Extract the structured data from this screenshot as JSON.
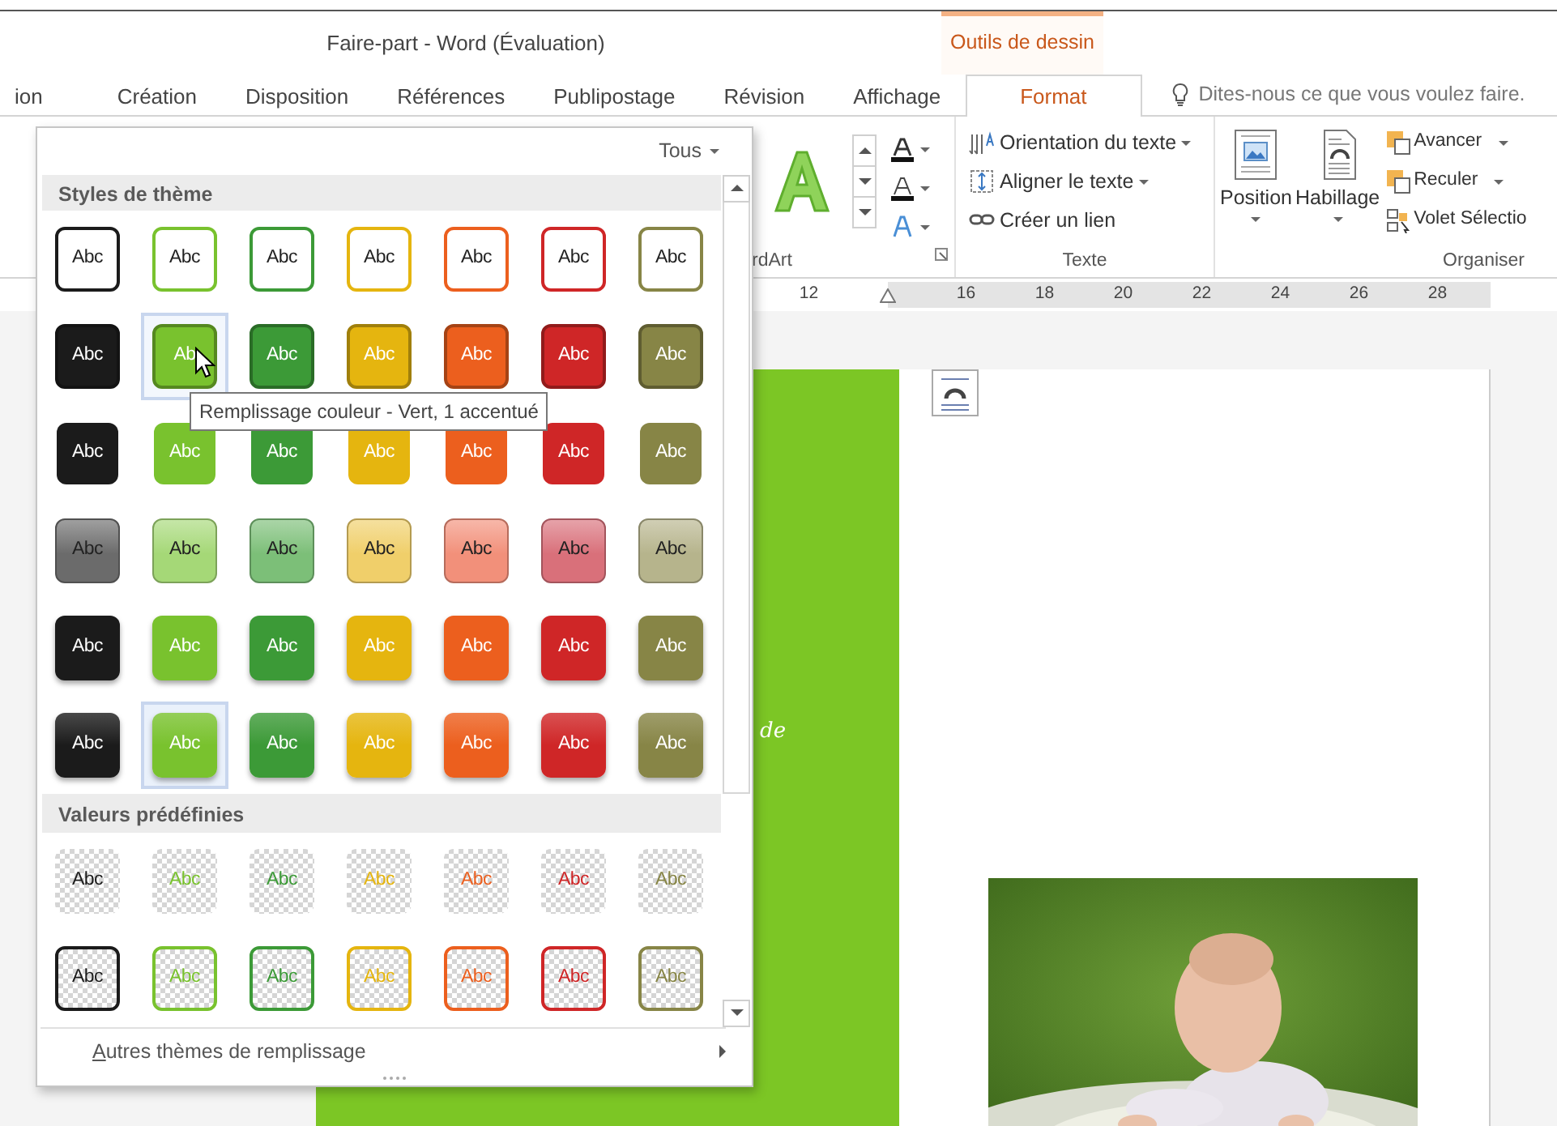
{
  "window": {
    "title": "Faire-part - Word (Évaluation)",
    "context_tab": "Outils de dessin"
  },
  "tabs": [
    {
      "label": "ion",
      "selected": false
    },
    {
      "label": "Création",
      "selected": false
    },
    {
      "label": "Disposition",
      "selected": false
    },
    {
      "label": "Références",
      "selected": false
    },
    {
      "label": "Publipostage",
      "selected": false
    },
    {
      "label": "Révision",
      "selected": false
    },
    {
      "label": "Affichage",
      "selected": false
    },
    {
      "label": "Format",
      "selected": true
    }
  ],
  "tell_me": {
    "placeholder": "Dites-nous ce que vous voulez faire."
  },
  "ribbon": {
    "wordart": {
      "label": "rdArt"
    },
    "texte": {
      "label": "Texte",
      "items": [
        {
          "label": "Orientation du texte",
          "dropdown": true
        },
        {
          "label": "Aligner le texte",
          "dropdown": true
        },
        {
          "label": "Créer un lien",
          "dropdown": false
        }
      ]
    },
    "organiser": {
      "label": "Organiser",
      "buttons": [
        {
          "label": "Position"
        },
        {
          "label": "Habillage"
        }
      ],
      "items": [
        {
          "label": "Avancer",
          "dropdown": true
        },
        {
          "label": "Reculer",
          "dropdown": true
        },
        {
          "label": "Volet Sélectio",
          "dropdown": false
        }
      ]
    }
  },
  "ruler": {
    "labels": [
      "12",
      "16",
      "18",
      "20",
      "22",
      "24",
      "26",
      "28"
    ]
  },
  "document": {
    "side_text": "de"
  },
  "gallery": {
    "filter": "Tous",
    "tooltip": "Remplissage couleur - Vert, 1 accentué",
    "footer": "Autres thèmes de remplissage",
    "sections": [
      {
        "title": "Styles de thème",
        "rows": [
          {
            "kind": "outline",
            "swatches": [
              {
                "label": "Abc",
                "color": "#1b1b1b",
                "selected": false,
                "hovered": false
              },
              {
                "label": "Abc",
                "color": "#79c22e",
                "selected": false,
                "hovered": false
              },
              {
                "label": "Abc",
                "color": "#3c9a37",
                "selected": false,
                "hovered": false
              },
              {
                "label": "Abc",
                "color": "#e5b50f",
                "selected": false,
                "hovered": false
              },
              {
                "label": "Abc",
                "color": "#ec5f1e",
                "selected": false,
                "hovered": false
              },
              {
                "label": "Abc",
                "color": "#cf2627",
                "selected": false,
                "hovered": false
              },
              {
                "label": "Abc",
                "color": "#878546",
                "selected": false,
                "hovered": false
              }
            ]
          },
          {
            "kind": "intense",
            "swatches": [
              {
                "label": "Abc",
                "color": "#1b1b1b",
                "selected": false,
                "hovered": false
              },
              {
                "label": "Ab",
                "color": "#79c22e",
                "selected": false,
                "hovered": true
              },
              {
                "label": "Abc",
                "color": "#3c9a37",
                "selected": false,
                "hovered": false
              },
              {
                "label": "Abc",
                "color": "#e5b50f",
                "selected": false,
                "hovered": false
              },
              {
                "label": "Abc",
                "color": "#ec5f1e",
                "selected": false,
                "hovered": false
              },
              {
                "label": "Abc",
                "color": "#cf2627",
                "selected": false,
                "hovered": false
              },
              {
                "label": "Abc",
                "color": "#878546",
                "selected": false,
                "hovered": false
              }
            ]
          },
          {
            "kind": "fill",
            "swatches": [
              {
                "label": "Abc",
                "color": "#1b1b1b",
                "selected": false,
                "hovered": false
              },
              {
                "label": "Abc",
                "color": "#79c22e",
                "selected": false,
                "hovered": false
              },
              {
                "label": "Abc",
                "color": "#3c9a37",
                "selected": false,
                "hovered": false
              },
              {
                "label": "Abc",
                "color": "#e5b50f",
                "selected": false,
                "hovered": false
              },
              {
                "label": "Abc",
                "color": "#ec5f1e",
                "selected": false,
                "hovered": false
              },
              {
                "label": "Abc",
                "color": "#cf2627",
                "selected": false,
                "hovered": false
              },
              {
                "label": "Abc",
                "color": "#878546",
                "selected": false,
                "hovered": false
              }
            ]
          },
          {
            "kind": "light",
            "swatches": [
              {
                "label": "Abc",
                "color": "#6b6b6b",
                "selected": false,
                "hovered": false
              },
              {
                "label": "Abc",
                "color": "#a5d877",
                "selected": false,
                "hovered": false
              },
              {
                "label": "Abc",
                "color": "#7cbf78",
                "selected": false,
                "hovered": false
              },
              {
                "label": "Abc",
                "color": "#f0cf6a",
                "selected": false,
                "hovered": false
              },
              {
                "label": "Abc",
                "color": "#f2907a",
                "selected": false,
                "hovered": false
              },
              {
                "label": "Abc",
                "color": "#d9707a",
                "selected": false,
                "hovered": false
              },
              {
                "label": "Abc",
                "color": "#b6b48c",
                "selected": false,
                "hovered": false
              }
            ]
          },
          {
            "kind": "shadow",
            "swatches": [
              {
                "label": "Abc",
                "color": "#1b1b1b",
                "selected": false,
                "hovered": false
              },
              {
                "label": "Abc",
                "color": "#79c22e",
                "selected": false,
                "hovered": false
              },
              {
                "label": "Abc",
                "color": "#3c9a37",
                "selected": false,
                "hovered": false
              },
              {
                "label": "Abc",
                "color": "#e5b50f",
                "selected": false,
                "hovered": false
              },
              {
                "label": "Abc",
                "color": "#ec5f1e",
                "selected": false,
                "hovered": false
              },
              {
                "label": "Abc",
                "color": "#cf2627",
                "selected": false,
                "hovered": false
              },
              {
                "label": "Abc",
                "color": "#878546",
                "selected": false,
                "hovered": false
              }
            ]
          },
          {
            "kind": "gradient",
            "swatches": [
              {
                "label": "Abc",
                "color": "#1b1b1b",
                "selected": false,
                "hovered": false
              },
              {
                "label": "Abc",
                "color": "#79c22e",
                "selected": true,
                "hovered": false
              },
              {
                "label": "Abc",
                "color": "#3c9a37",
                "selected": false,
                "hovered": false
              },
              {
                "label": "Abc",
                "color": "#e5b50f",
                "selected": false,
                "hovered": false
              },
              {
                "label": "Abc",
                "color": "#ec5f1e",
                "selected": false,
                "hovered": false
              },
              {
                "label": "Abc",
                "color": "#cf2627",
                "selected": false,
                "hovered": false
              },
              {
                "label": "Abc",
                "color": "#878546",
                "selected": false,
                "hovered": false
              }
            ]
          }
        ]
      },
      {
        "title": "Valeurs prédéfinies",
        "rows": [
          {
            "kind": "preset",
            "swatches": [
              {
                "label": "Abc",
                "color": "#1b1b1b",
                "selected": false,
                "hovered": false
              },
              {
                "label": "Abc",
                "color": "#79c22e",
                "selected": false,
                "hovered": false
              },
              {
                "label": "Abc",
                "color": "#3c9a37",
                "selected": false,
                "hovered": false
              },
              {
                "label": "Abc",
                "color": "#e5b50f",
                "selected": false,
                "hovered": false
              },
              {
                "label": "Abc",
                "color": "#ec5f1e",
                "selected": false,
                "hovered": false
              },
              {
                "label": "Abc",
                "color": "#cf2627",
                "selected": false,
                "hovered": false
              },
              {
                "label": "Abc",
                "color": "#878546",
                "selected": false,
                "hovered": false
              }
            ]
          },
          {
            "kind": "preset-outline",
            "swatches": [
              {
                "label": "Abc",
                "color": "#1b1b1b",
                "selected": false,
                "hovered": false
              },
              {
                "label": "Abc",
                "color": "#79c22e",
                "selected": false,
                "hovered": false
              },
              {
                "label": "Abc",
                "color": "#3c9a37",
                "selected": false,
                "hovered": false
              },
              {
                "label": "Abc",
                "color": "#e5b50f",
                "selected": false,
                "hovered": false
              },
              {
                "label": "Abc",
                "color": "#ec5f1e",
                "selected": false,
                "hovered": false
              },
              {
                "label": "Abc",
                "color": "#cf2627",
                "selected": false,
                "hovered": false
              },
              {
                "label": "Abc",
                "color": "#878546",
                "selected": false,
                "hovered": false
              }
            ]
          }
        ]
      }
    ]
  }
}
